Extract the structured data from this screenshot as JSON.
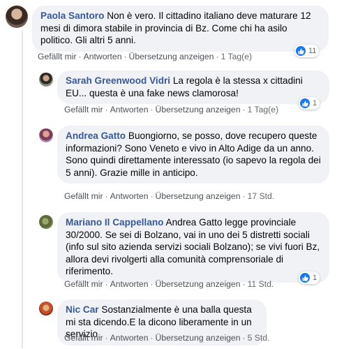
{
  "comments": [
    {
      "author": "Paola Santoro",
      "text": "Non è vero. Il cittadino italiano deve maturare 12 mesi di dimora stabile in provincia di Bz. Come chi ha asilo politico. Gli altri 5 anni.",
      "like": "Gefällt mir",
      "reply": "Antworten",
      "translate": "Übersetzung anzeigen",
      "time": "1 Tag(e)",
      "reactions": "11"
    },
    {
      "author": "Sarah Greenwood Vidri",
      "text": "La regola è la stessa x cittadini EU... questa è una fake news clamorosa!",
      "like": "Gefällt mir",
      "reply": "Antworten",
      "translate": "Übersetzung anzeigen",
      "time": "1 Tag(e)",
      "reactions": "1"
    },
    {
      "author": "Andrea Gatto",
      "text": "Buongiorno, se posso, dove recupero queste informazioni? Sono Veneto e vivo in Alto Adige da un anno. Sono quindi direttamente interessato (io sapevo la regola dei 5 anni). Grazie mille in anticipo.",
      "like": "Gefällt mir",
      "reply": "Antworten",
      "translate": "Übersetzung anzeigen",
      "time": "17 Std."
    },
    {
      "author": "Mariano Il Cappellano",
      "text": "Andrea Gatto legge provinciale 30/2000. Se sei di Bolzano, vai in uno dei 5 distretti sociali (info sul sito azienda servizi sociali Bolzano); se vivi fuori Bz, allora devi rivolgerti alla comunità comprensoriale di riferimento.",
      "like": "Gefällt mir",
      "reply": "Antworten",
      "translate": "Übersetzung anzeigen",
      "time": "11 Std.",
      "reactions": "1"
    },
    {
      "author": "Nic Car",
      "text": "Sostanzialmente è una balla questa mi sta dicendo.E la dicono liberamente in un servizio.",
      "like": "Gefällt mir",
      "reply": "Antworten",
      "translate": "Übersetzung anzeigen",
      "time": "5 Std."
    }
  ],
  "separator": "·",
  "colors": {
    "author": "#385898",
    "bubble": "#f0f2f5",
    "like_blue": "#1877f2",
    "meta": "#65676b"
  },
  "icons": [
    "avatar",
    "like-thumb-icon"
  ]
}
